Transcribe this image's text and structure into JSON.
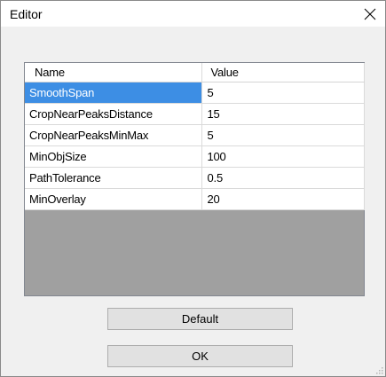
{
  "window": {
    "title": "Editor"
  },
  "grid": {
    "columns": [
      "Name",
      "Value"
    ],
    "rows": [
      {
        "name": "SmoothSpan",
        "value": "5"
      },
      {
        "name": "CropNearPeaksDistance",
        "value": "15"
      },
      {
        "name": "CropNearPeaksMinMax",
        "value": "5"
      },
      {
        "name": "MinObjSize",
        "value": "100"
      },
      {
        "name": "PathTolerance",
        "value": "0.5"
      },
      {
        "name": "MinOverlay",
        "value": "20"
      }
    ],
    "selected_row": 0
  },
  "buttons": {
    "default_label": "Default",
    "ok_label": "OK"
  },
  "colors": {
    "selection": "#3d8ee4",
    "grid_background": "#a0a0a0",
    "dialog_background": "#f0f0f0"
  },
  "icons": {
    "close": "close-icon",
    "resize": "resize-grip-icon"
  }
}
